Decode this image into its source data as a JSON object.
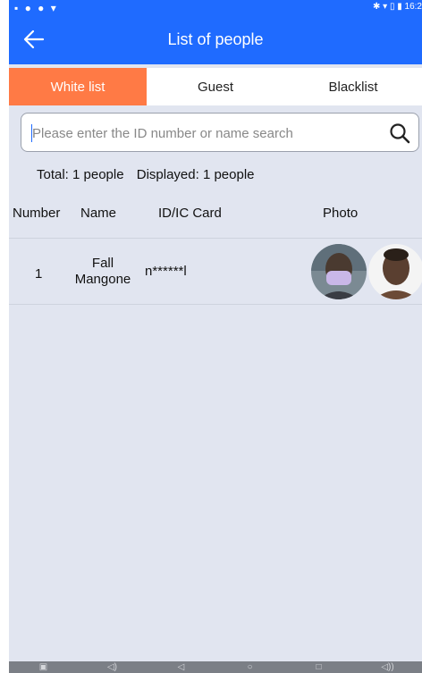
{
  "status_bar": {
    "left_icons": "▪ ● ● ▾",
    "right_text": "✱ ▾ ▯ ▮ 16:2"
  },
  "header": {
    "title": "List of people",
    "back_icon": "arrow-left-icon"
  },
  "tabs": [
    {
      "label": "White list",
      "active": true
    },
    {
      "label": "Guest",
      "active": false
    },
    {
      "label": "Blacklist",
      "active": false
    }
  ],
  "search": {
    "placeholder": "Please enter the ID number or name search",
    "value": "",
    "icon": "search-icon"
  },
  "summary": {
    "total": "Total: 1 people",
    "displayed": "Displayed: 1 people"
  },
  "table": {
    "columns": [
      "Number",
      "Name",
      "ID/IC Card",
      "Photo"
    ],
    "rows": [
      {
        "number": "1",
        "name": "Fall Mangone",
        "card": "n******l",
        "photos": [
          "masked-face-photo",
          "face-photo"
        ]
      }
    ]
  },
  "nav_bar": {
    "icons": [
      "screenshot-icon",
      "volume-down-icon",
      "back-icon",
      "home-icon",
      "recents-icon",
      "volume-up-icon"
    ],
    "glyphs": [
      "▣",
      "◁)",
      "◁",
      "○",
      "□",
      "◁))"
    ]
  },
  "colors": {
    "accent": "#1f6bff",
    "active_tab": "#ff7a45",
    "background": "#e1e5f0"
  }
}
